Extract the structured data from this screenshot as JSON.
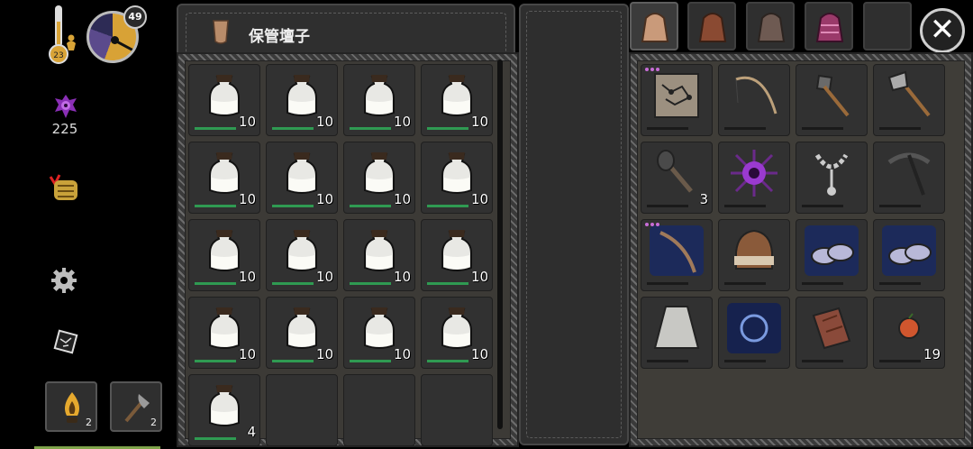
{
  "hud": {
    "temperature": "23",
    "day": "49",
    "sanity": "225",
    "quick_slots": [
      {
        "name": "torch",
        "count": "2"
      },
      {
        "name": "axe",
        "count": "2"
      }
    ]
  },
  "storage": {
    "title": "保管壇子",
    "slots": [
      {
        "item": "milk-jar",
        "count": "10"
      },
      {
        "item": "milk-jar",
        "count": "10"
      },
      {
        "item": "milk-jar",
        "count": "10"
      },
      {
        "item": "milk-jar",
        "count": "10"
      },
      {
        "item": "milk-jar",
        "count": "10"
      },
      {
        "item": "milk-jar",
        "count": "10"
      },
      {
        "item": "milk-jar",
        "count": "10"
      },
      {
        "item": "milk-jar",
        "count": "10"
      },
      {
        "item": "milk-jar",
        "count": "10"
      },
      {
        "item": "milk-jar",
        "count": "10"
      },
      {
        "item": "milk-jar",
        "count": "10"
      },
      {
        "item": "milk-jar",
        "count": "10"
      },
      {
        "item": "milk-jar",
        "count": "10"
      },
      {
        "item": "milk-jar",
        "count": "10"
      },
      {
        "item": "milk-jar",
        "count": "10"
      },
      {
        "item": "milk-jar",
        "count": "10"
      },
      {
        "item": "milk-jar",
        "count": "4"
      },
      {
        "item": "",
        "count": ""
      },
      {
        "item": "",
        "count": ""
      },
      {
        "item": "",
        "count": ""
      }
    ]
  },
  "backpack": {
    "tabs": [
      "backpack-tab-1",
      "backpack-tab-2",
      "backpack-tab-3",
      "backpack-tab-4",
      "backpack-tab-5"
    ],
    "close_label": "✕",
    "slots": [
      {
        "item": "map-scroll",
        "count": ""
      },
      {
        "item": "fishing-rod",
        "count": ""
      },
      {
        "item": "shovel",
        "count": ""
      },
      {
        "item": "axe",
        "count": ""
      },
      {
        "item": "spiked-club",
        "count": "3"
      },
      {
        "item": "shadow-orb",
        "count": ""
      },
      {
        "item": "chain-amulet",
        "count": ""
      },
      {
        "item": "pickaxe",
        "count": ""
      },
      {
        "item": "magic-staff",
        "count": ""
      },
      {
        "item": "fur-hat",
        "count": ""
      },
      {
        "item": "slippers",
        "count": ""
      },
      {
        "item": "slippers",
        "count": ""
      },
      {
        "item": "cloak",
        "count": ""
      },
      {
        "item": "magic-ring",
        "count": ""
      },
      {
        "item": "wood-logs",
        "count": ""
      },
      {
        "item": "red-berry",
        "count": "19"
      }
    ]
  }
}
